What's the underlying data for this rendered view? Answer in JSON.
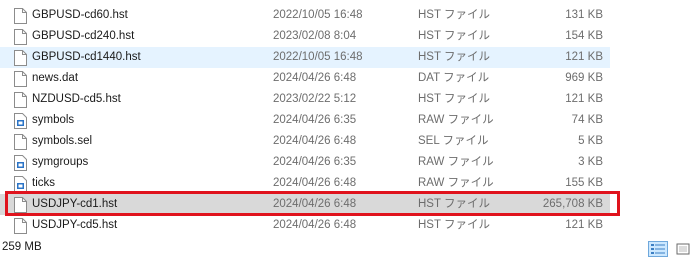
{
  "files": [
    {
      "name": "GBPUSD-cd60.hst",
      "date": "2022/10/05 16:48",
      "type": "HST ファイル",
      "size": "131 KB",
      "icon": "blank-file-icon"
    },
    {
      "name": "GBPUSD-cd240.hst",
      "date": "2023/02/08 8:04",
      "type": "HST ファイル",
      "size": "154 KB",
      "icon": "blank-file-icon"
    },
    {
      "name": "GBPUSD-cd1440.hst",
      "date": "2022/10/05 16:48",
      "type": "HST ファイル",
      "size": "121 KB",
      "icon": "blank-file-icon"
    },
    {
      "name": "news.dat",
      "date": "2024/04/26 6:48",
      "type": "DAT ファイル",
      "size": "969 KB",
      "icon": "blank-file-icon"
    },
    {
      "name": "NZDUSD-cd5.hst",
      "date": "2023/02/22 5:12",
      "type": "HST ファイル",
      "size": "121 KB",
      "icon": "blank-file-icon"
    },
    {
      "name": "symbols",
      "date": "2024/04/26 6:35",
      "type": "RAW ファイル",
      "size": "74 KB",
      "icon": "data-file-icon"
    },
    {
      "name": "symbols.sel",
      "date": "2024/04/26 6:48",
      "type": "SEL ファイル",
      "size": "5 KB",
      "icon": "blank-file-icon"
    },
    {
      "name": "symgroups",
      "date": "2024/04/26 6:35",
      "type": "RAW ファイル",
      "size": "3 KB",
      "icon": "data-file-icon"
    },
    {
      "name": "ticks",
      "date": "2024/04/26 6:48",
      "type": "RAW ファイル",
      "size": "155 KB",
      "icon": "data-file-icon"
    },
    {
      "name": "USDJPY-cd1.hst",
      "date": "2024/04/26 6:48",
      "type": "HST ファイル",
      "size": "265,708 KB",
      "icon": "blank-file-icon"
    },
    {
      "name": "USDJPY-cd5.hst",
      "date": "2024/04/26 6:48",
      "type": "HST ファイル",
      "size": "121 KB",
      "icon": "blank-file-icon"
    }
  ],
  "status_bar": {
    "size_text": "259 MB"
  },
  "colors": {
    "hover_row": "#e5f3ff",
    "selected_row": "#d9d9d9",
    "highlight_border": "#e0131d"
  }
}
